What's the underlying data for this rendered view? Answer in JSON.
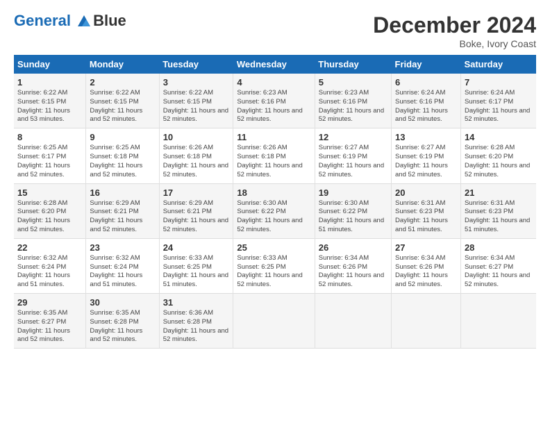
{
  "logo": {
    "line1": "General",
    "line2": "Blue"
  },
  "title": "December 2024",
  "subtitle": "Boke, Ivory Coast",
  "days_header": [
    "Sunday",
    "Monday",
    "Tuesday",
    "Wednesday",
    "Thursday",
    "Friday",
    "Saturday"
  ],
  "weeks": [
    [
      {
        "day": "1",
        "rise": "6:22 AM",
        "set": "6:15 PM",
        "daylight": "11 hours and 53 minutes."
      },
      {
        "day": "2",
        "rise": "6:22 AM",
        "set": "6:15 PM",
        "daylight": "11 hours and 52 minutes."
      },
      {
        "day": "3",
        "rise": "6:22 AM",
        "set": "6:15 PM",
        "daylight": "11 hours and 52 minutes."
      },
      {
        "day": "4",
        "rise": "6:23 AM",
        "set": "6:16 PM",
        "daylight": "11 hours and 52 minutes."
      },
      {
        "day": "5",
        "rise": "6:23 AM",
        "set": "6:16 PM",
        "daylight": "11 hours and 52 minutes."
      },
      {
        "day": "6",
        "rise": "6:24 AM",
        "set": "6:16 PM",
        "daylight": "11 hours and 52 minutes."
      },
      {
        "day": "7",
        "rise": "6:24 AM",
        "set": "6:17 PM",
        "daylight": "11 hours and 52 minutes."
      }
    ],
    [
      {
        "day": "8",
        "rise": "6:25 AM",
        "set": "6:17 PM",
        "daylight": "11 hours and 52 minutes."
      },
      {
        "day": "9",
        "rise": "6:25 AM",
        "set": "6:18 PM",
        "daylight": "11 hours and 52 minutes."
      },
      {
        "day": "10",
        "rise": "6:26 AM",
        "set": "6:18 PM",
        "daylight": "11 hours and 52 minutes."
      },
      {
        "day": "11",
        "rise": "6:26 AM",
        "set": "6:18 PM",
        "daylight": "11 hours and 52 minutes."
      },
      {
        "day": "12",
        "rise": "6:27 AM",
        "set": "6:19 PM",
        "daylight": "11 hours and 52 minutes."
      },
      {
        "day": "13",
        "rise": "6:27 AM",
        "set": "6:19 PM",
        "daylight": "11 hours and 52 minutes."
      },
      {
        "day": "14",
        "rise": "6:28 AM",
        "set": "6:20 PM",
        "daylight": "11 hours and 52 minutes."
      }
    ],
    [
      {
        "day": "15",
        "rise": "6:28 AM",
        "set": "6:20 PM",
        "daylight": "11 hours and 52 minutes."
      },
      {
        "day": "16",
        "rise": "6:29 AM",
        "set": "6:21 PM",
        "daylight": "11 hours and 52 minutes."
      },
      {
        "day": "17",
        "rise": "6:29 AM",
        "set": "6:21 PM",
        "daylight": "11 hours and 52 minutes."
      },
      {
        "day": "18",
        "rise": "6:30 AM",
        "set": "6:22 PM",
        "daylight": "11 hours and 52 minutes."
      },
      {
        "day": "19",
        "rise": "6:30 AM",
        "set": "6:22 PM",
        "daylight": "11 hours and 51 minutes."
      },
      {
        "day": "20",
        "rise": "6:31 AM",
        "set": "6:23 PM",
        "daylight": "11 hours and 51 minutes."
      },
      {
        "day": "21",
        "rise": "6:31 AM",
        "set": "6:23 PM",
        "daylight": "11 hours and 51 minutes."
      }
    ],
    [
      {
        "day": "22",
        "rise": "6:32 AM",
        "set": "6:24 PM",
        "daylight": "11 hours and 51 minutes."
      },
      {
        "day": "23",
        "rise": "6:32 AM",
        "set": "6:24 PM",
        "daylight": "11 hours and 51 minutes."
      },
      {
        "day": "24",
        "rise": "6:33 AM",
        "set": "6:25 PM",
        "daylight": "11 hours and 51 minutes."
      },
      {
        "day": "25",
        "rise": "6:33 AM",
        "set": "6:25 PM",
        "daylight": "11 hours and 52 minutes."
      },
      {
        "day": "26",
        "rise": "6:34 AM",
        "set": "6:26 PM",
        "daylight": "11 hours and 52 minutes."
      },
      {
        "day": "27",
        "rise": "6:34 AM",
        "set": "6:26 PM",
        "daylight": "11 hours and 52 minutes."
      },
      {
        "day": "28",
        "rise": "6:34 AM",
        "set": "6:27 PM",
        "daylight": "11 hours and 52 minutes."
      }
    ],
    [
      {
        "day": "29",
        "rise": "6:35 AM",
        "set": "6:27 PM",
        "daylight": "11 hours and 52 minutes."
      },
      {
        "day": "30",
        "rise": "6:35 AM",
        "set": "6:28 PM",
        "daylight": "11 hours and 52 minutes."
      },
      {
        "day": "31",
        "rise": "6:36 AM",
        "set": "6:28 PM",
        "daylight": "11 hours and 52 minutes."
      },
      null,
      null,
      null,
      null
    ]
  ]
}
